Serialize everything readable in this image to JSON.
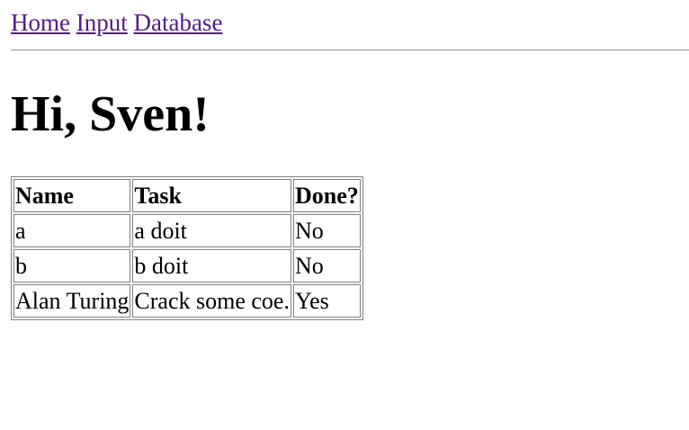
{
  "nav": {
    "links": [
      "Home",
      "Input",
      "Database"
    ]
  },
  "heading": "Hi, Sven!",
  "table": {
    "headers": [
      "Name",
      "Task",
      "Done?"
    ],
    "rows": [
      [
        "a",
        "a doit",
        "No"
      ],
      [
        "b",
        "b doit",
        "No"
      ],
      [
        "Alan Turing",
        "Crack some coe.",
        "Yes"
      ]
    ]
  },
  "colors": {
    "link": "#551a8b",
    "text": "#000000",
    "background": "#ffffff",
    "border": "#808080"
  }
}
